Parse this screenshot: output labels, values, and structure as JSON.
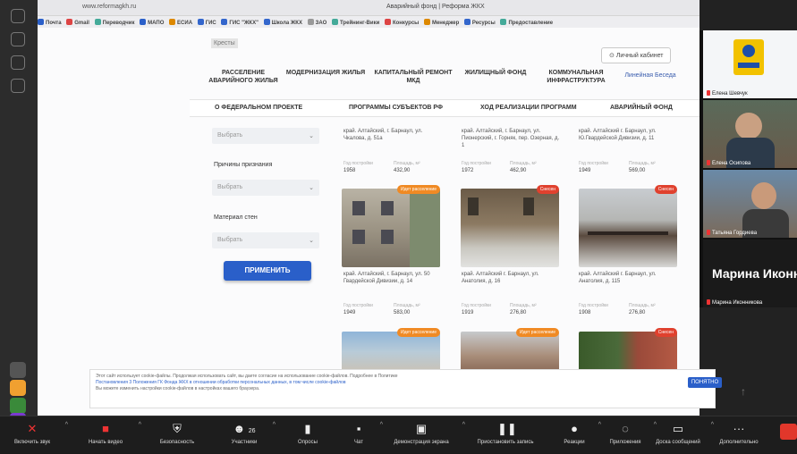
{
  "browser": {
    "url": "www.reformagkh.ru",
    "title": "Аварийный фонд | Реформа ЖКХ",
    "bookmarks": [
      "Почта",
      "Gmail",
      "Переводчик",
      "МАПО",
      "ЕСИА",
      "ГИС",
      "ГИС \"ЖКХ\"",
      "Школа ЖКХ",
      "ЗАО",
      "Трейнинг-Вики",
      "Конкурсы",
      "Менеджер",
      "Ресурсы",
      "Предоставление"
    ]
  },
  "site": {
    "logo": "Кресты",
    "cabinet": "Личный кабинет",
    "nav": [
      {
        "label": "РАССЕЛЕНИЕ АВАРИЙНОГО ЖИЛЬЯ"
      },
      {
        "label": "МОДЕРНИЗАЦИЯ ЖИЛЬЯ"
      },
      {
        "label": "КАПИТАЛЬНЫЙ РЕМОНТ МКД"
      },
      {
        "label": "ЖИЛИЩНЫЙ ФОНД"
      },
      {
        "label": "КОММУНАЛЬНАЯ ИНФРАСТРУКТУРА"
      },
      {
        "label": "Линейная Беседа"
      }
    ],
    "subnav": [
      "О ФЕДЕРАЛЬНОМ ПРОЕКТЕ",
      "ПРОГРАММЫ СУБЪЕКТОВ РФ",
      "ХОД РЕАЛИЗАЦИИ ПРОГРАММ",
      "АВАРИЙНЫЙ ФОНД"
    ]
  },
  "filters": {
    "select1_placeholder": "Выбрать",
    "reason_label": "Причины признания",
    "reason_placeholder": "Выбрать",
    "walls_label": "Материал стен",
    "walls_placeholder": "Выбрать",
    "apply_label": "ПРИМЕНИТЬ"
  },
  "top_cards": [
    {
      "addr": "край. Алтайский, г. Барнаул, ул. Чкалова, д. 51а",
      "year_label": "Год постройки",
      "year": "1958",
      "area_label": "Площадь, м²",
      "area": "432,90"
    },
    {
      "addr": "край. Алтайский, г. Барнаул, ул. Пионерский, г. Горняк, пер. Озерная, д. 1",
      "year_label": "Год постройки",
      "year": "1972",
      "area_label": "Площадь, м²",
      "area": "462,90"
    },
    {
      "addr": "край. Алтайский г. Барнаул, ул. Ю.Гвардейской Дивизии, д. 11",
      "year_label": "Год постройки",
      "year": "1949",
      "area_label": "Площадь, м²",
      "area": "569,00"
    }
  ],
  "cards": [
    {
      "tag": "Идет расселение",
      "tag_color": "#f08a24",
      "addr": "край. Алтайский, г. Барнаул, ул. 50 Гвардейской Дивизии, д. 14",
      "year_label": "Год постройки",
      "year": "1949",
      "area_label": "Площадь, м²",
      "area": "583,00"
    },
    {
      "tag": "Снесен",
      "tag_color": "#e0412e",
      "addr": "край. Алтайский г. Барнаул, ул. Анатолия, д. 16",
      "year_label": "Год постройки",
      "year": "1919",
      "area_label": "Площадь, м²",
      "area": "276,80"
    },
    {
      "tag": "Снесен",
      "tag_color": "#e0412e",
      "addr": "край. Алтайский г. Барнаул, ул. Анатолия, д. 115",
      "year_label": "Год постройки",
      "year": "1908",
      "area_label": "Площадь, м²",
      "area": "276,80"
    }
  ],
  "bottom_cards": [
    {
      "tag": "Идет расселение",
      "tag_color": "#f08a24"
    },
    {
      "tag": "Идет расселение",
      "tag_color": "#f08a24"
    },
    {
      "tag": "Снесен",
      "tag_color": "#e0412e"
    }
  ],
  "cookie": {
    "text1": "Этот сайт использует cookie-файлы. Продолжая использовать сайт, вы даете согласие на использование cookie-файлов. Подробнее в Политике",
    "text2": "Постановления 3 Положения ГК Фонда ЖКХ в отношении обработки персональных данных, в том числе cookie-файлов",
    "text3": "Вы можете изменить настройки cookie-файлов в настройках вашего браузера.",
    "ok_label": "ПОНЯТНО"
  },
  "participants": [
    {
      "name": "Елена Шевчук"
    },
    {
      "name": "Елена Осипова"
    },
    {
      "name": "Татьяна Гордиева"
    },
    {
      "name": "Марина Иконникова",
      "big": "Марина Иконн"
    }
  ],
  "toolbar": {
    "mute": "Включить звук",
    "video": "Начать видео",
    "security": "Безопасность",
    "participants": "Участники",
    "participants_count": "26",
    "polls": "Опросы",
    "chat": "Чат",
    "share": "Демонстрация экрана",
    "pause_share": "Приостановить запись",
    "reactions": "Реакции",
    "apps": "Приложения",
    "whiteboards": "Доска сообщений",
    "more": "Дополнительно"
  }
}
